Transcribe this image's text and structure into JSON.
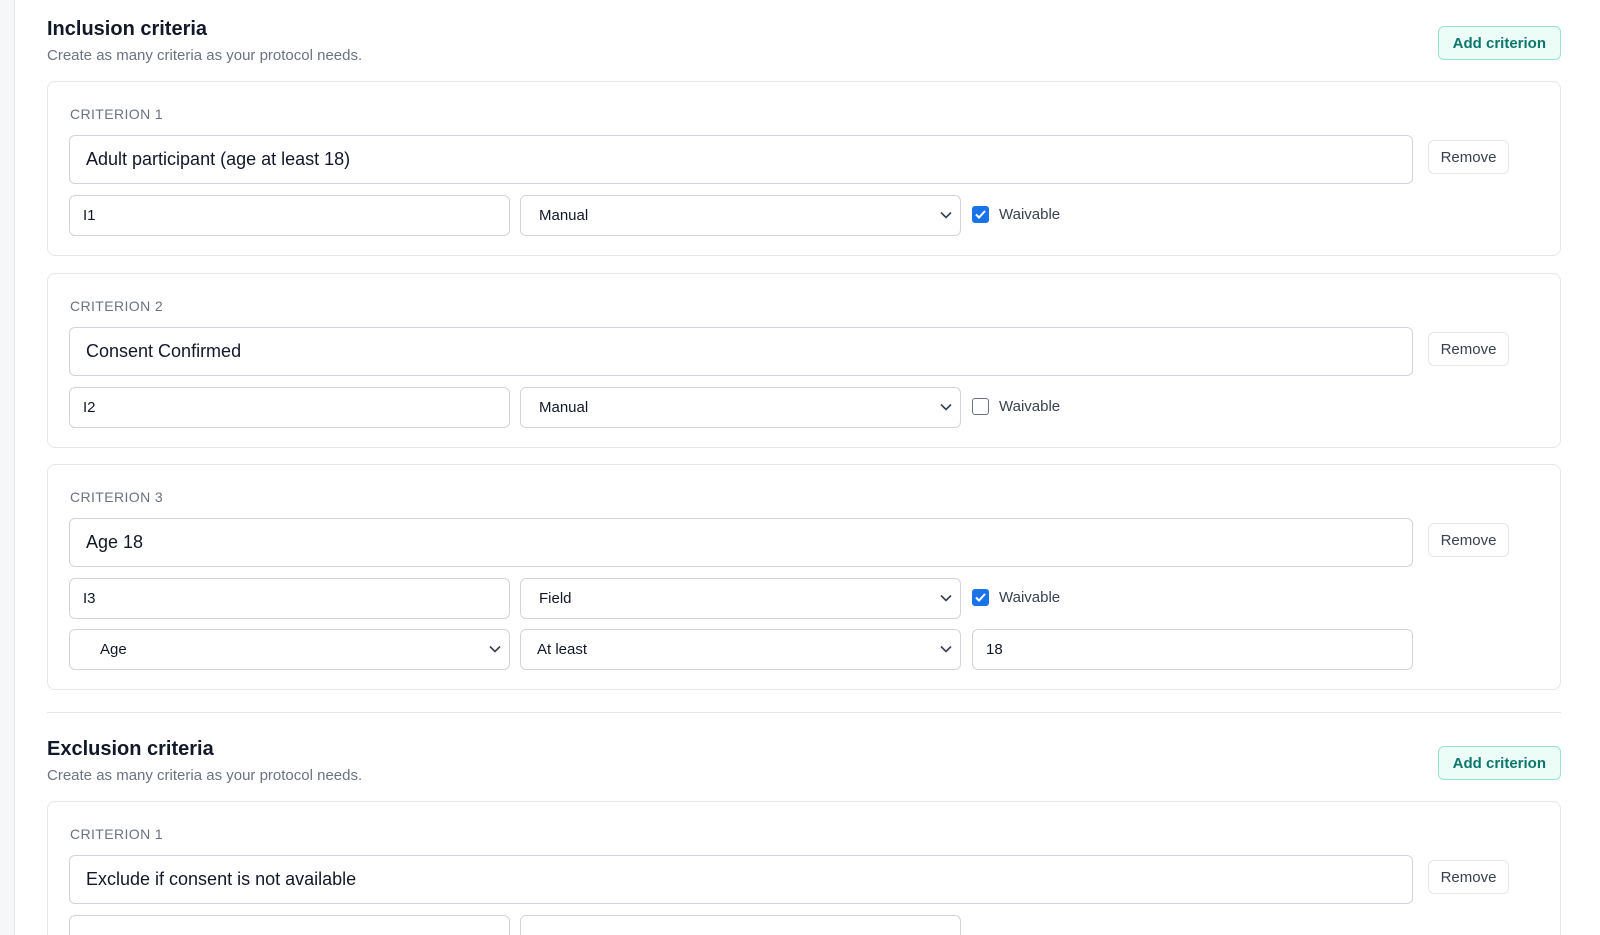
{
  "inclusion": {
    "title": "Inclusion criteria",
    "subtitle": "Create as many criteria as your protocol needs.",
    "add_label": "Add criterion",
    "criteria": [
      {
        "label": "CRITERION 1",
        "text": "Adult participant (age at least 18)",
        "code": "I1",
        "type": "Manual",
        "waivable_label": "Waivable",
        "waivable": true,
        "remove_label": "Remove"
      },
      {
        "label": "CRITERION 2",
        "text": "Consent Confirmed",
        "code": "I2",
        "type": "Manual",
        "waivable_label": "Waivable",
        "waivable": false,
        "remove_label": "Remove"
      },
      {
        "label": "CRITERION 3",
        "text": "Age 18",
        "code": "I3",
        "type": "Field",
        "waivable_label": "Waivable",
        "waivable": true,
        "remove_label": "Remove",
        "field": "Age",
        "operator": "At least",
        "value": "18"
      }
    ]
  },
  "exclusion": {
    "title": "Exclusion criteria",
    "subtitle": "Create as many criteria as your protocol needs.",
    "add_label": "Add criterion",
    "criteria": [
      {
        "label": "CRITERION 1",
        "text": "Exclude if consent is not available",
        "remove_label": "Remove"
      }
    ]
  },
  "colors": {
    "accent": "#0f766e",
    "accent_bg": "#ecfdf7",
    "checkbox": "#1a73e8"
  }
}
